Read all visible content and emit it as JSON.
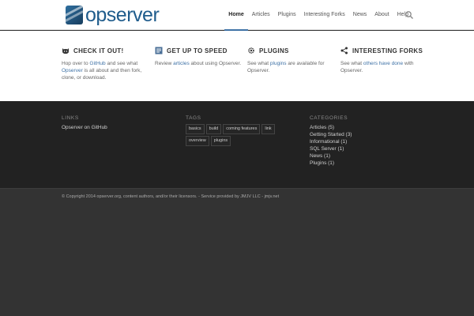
{
  "site": {
    "logo_text": "opserver"
  },
  "nav": {
    "items": [
      {
        "label": "Home",
        "active": true
      },
      {
        "label": "Articles"
      },
      {
        "label": "Plugins"
      },
      {
        "label": "Interesting Forks"
      },
      {
        "label": "News"
      },
      {
        "label": "About"
      },
      {
        "label": "Help"
      }
    ],
    "search_icon": "search-icon"
  },
  "features": [
    {
      "icon": "github-icon",
      "title": "CHECK IT OUT!",
      "body_pre": "Hop over to ",
      "link1": "GitHub",
      "body_mid": " and see what ",
      "link2": "Opserver",
      "body_post": " is all about and then fork, clone, or download."
    },
    {
      "icon": "document-icon",
      "title": "GET UP TO SPEED",
      "body_pre": "Review ",
      "link": "articles",
      "body_post": " about using Opserver."
    },
    {
      "icon": "gear-icon",
      "title": "PLUGINS",
      "body_pre": "See what ",
      "link": "plugins",
      "body_post": " are available for Opserver."
    },
    {
      "icon": "share-icon",
      "title": "INTERESTING FORKS",
      "body_pre": "See what ",
      "link": "others have done",
      "body_post": " with Opserver."
    }
  ],
  "widgets": {
    "links": {
      "title": "LINKS",
      "items": [
        "Opserver on GitHub"
      ]
    },
    "tags": {
      "title": "TAGS",
      "items": [
        "basics",
        "build",
        "coming features",
        "link",
        "overview",
        "plugins"
      ]
    },
    "categories": {
      "title": "CATEGORIES",
      "items": [
        "Articles (5)",
        "Getting Started (3)",
        "Informational (1)",
        "SQL Server (1)",
        "News (1)",
        "Plugins (1)"
      ]
    }
  },
  "footer": {
    "copyright": "© Copyright 2014 opserver.org, content authors, and/or their licensors. - Service provided by JMJV LLC - jmjv.net"
  },
  "colors": {
    "accent": "#3f72a6",
    "widget_bg": "#222222",
    "footer_bg": "#333333"
  }
}
